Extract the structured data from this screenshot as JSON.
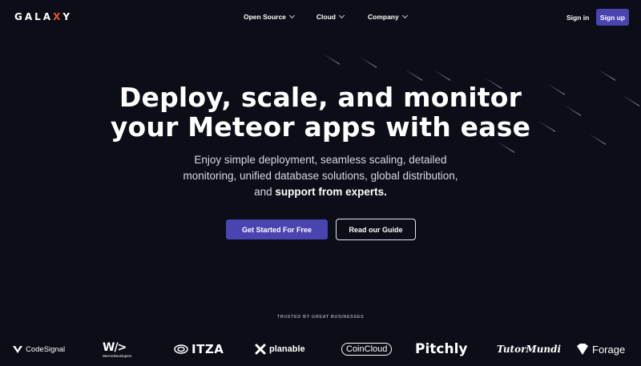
{
  "header": {
    "logo": {
      "pre": "GALA",
      "x": "X",
      "post": "Y"
    },
    "nav": [
      {
        "label": "Open Source"
      },
      {
        "label": "Cloud"
      },
      {
        "label": "Company"
      }
    ],
    "signin_label": "Sign in",
    "signup_label": "Sign up"
  },
  "hero": {
    "title_line1": "Deploy, scale, and monitor",
    "title_line2": "your Meteor apps with ease",
    "subtitle": "Enjoy simple deployment, seamless scaling, detailed monitoring, unified database solutions, global distribution, and",
    "subtitle_bold": "support from experts.",
    "primary_button": "Get Started For Free",
    "secondary_button": "Read our Guide"
  },
  "trusted": {
    "label": "TRUSTED BY GREAT BUSINESSES",
    "logos": [
      {
        "name": "CodeSignal",
        "icon": "codesignal-icon"
      },
      {
        "name": "WeAreDevelopers",
        "mark": "W/>"
      },
      {
        "name": "ITZA"
      },
      {
        "name": "planable"
      },
      {
        "name": "CoinCloud"
      },
      {
        "name": "Pitchly"
      },
      {
        "name": "TutorMundi"
      },
      {
        "name": "Forage"
      }
    ]
  },
  "colors": {
    "background": "#0b0d17",
    "accent": "#4a44b0",
    "logo_x": "#e8562a"
  }
}
